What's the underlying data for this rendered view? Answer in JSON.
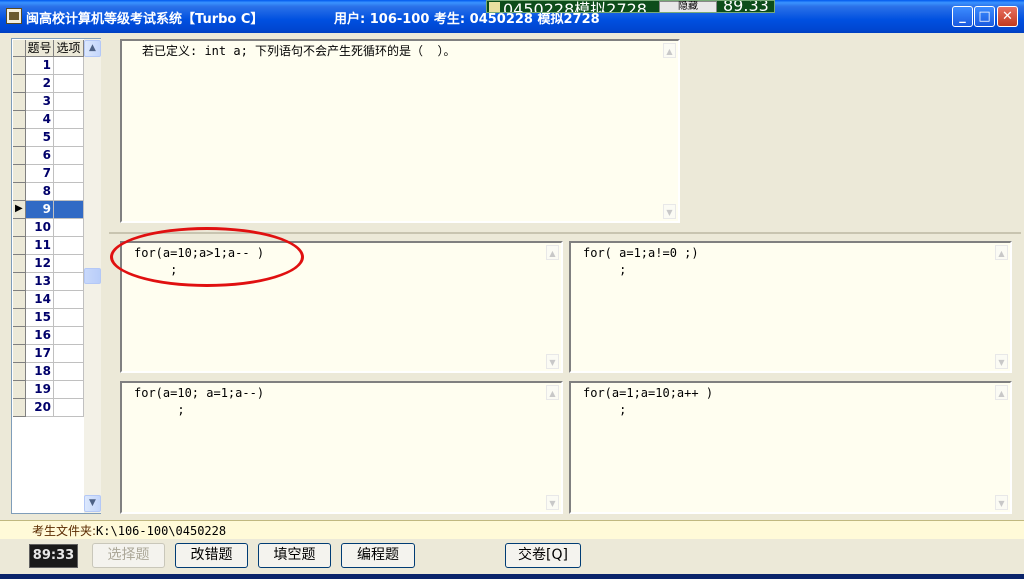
{
  "window": {
    "title": "闽高校计算机等级考试系统【Turbo C】",
    "user_info": "用户: 106-100 考生: 0450228 模拟2728",
    "buttons": {
      "minimize": "_",
      "maximize": "□",
      "close": "✕"
    }
  },
  "float_bar": {
    "text": "0450228模拟2728",
    "hide_label": "隐藏",
    "time": "89.33"
  },
  "grid": {
    "headers": {
      "number": "题号",
      "option": "选项"
    },
    "rows": [
      "1",
      "2",
      "3",
      "4",
      "5",
      "6",
      "7",
      "8",
      "9",
      "10",
      "11",
      "12",
      "13",
      "14",
      "15",
      "16",
      "17",
      "18",
      "19",
      "20"
    ],
    "selected": "9"
  },
  "question": {
    "text": "若已定义: int a; 下列语句不会产生死循环的是（  ）。"
  },
  "options": {
    "a": "for(a=10;a>1;a-- )\n     ;",
    "b": "for( a=1;a!=0 ;)\n     ;",
    "c": "for(a=10; a=1;a--)\n      ;",
    "d": "for(a=1;a=10;a++ )\n     ;"
  },
  "status": {
    "label": "考生文件夹:",
    "path": "K:\\106-100\\0450228"
  },
  "toolbar": {
    "timer": "89:33",
    "choice": "选择题",
    "error_fix": "改错题",
    "fill_blank": "填空题",
    "programming": "编程题",
    "submit": "交卷[Q]"
  },
  "colors": {
    "title_bar": "#0054e3",
    "panel_bg": "#fffef0",
    "highlight": "#316ac5",
    "annotation": "#e01010"
  }
}
